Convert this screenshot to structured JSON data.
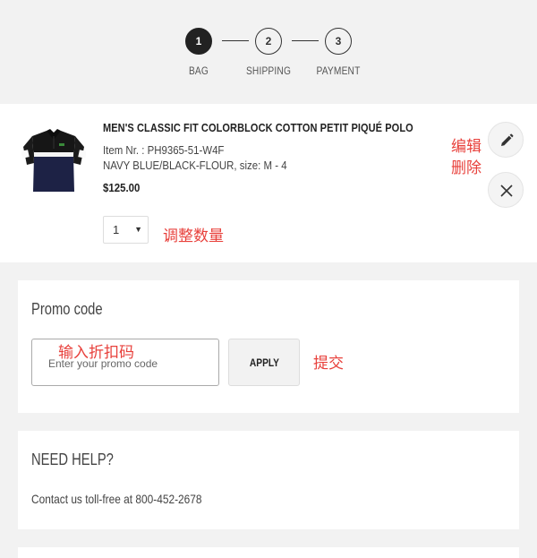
{
  "steps": [
    {
      "number": "1",
      "label": "BAG",
      "active": true
    },
    {
      "number": "2",
      "label": "SHIPPING",
      "active": false
    },
    {
      "number": "3",
      "label": "PAYMENT",
      "active": false
    }
  ],
  "cart_item": {
    "title": "MEN'S CLASSIC FIT COLORBLOCK COTTON PETIT PIQUÉ POLO",
    "item_number": "Item Nr. : PH9365-51-W4F",
    "variant": "NAVY BLUE/BLACK-FLOUR, size: M - 4",
    "price": "$125.00",
    "quantity": "1",
    "image_icon": "polo-shirt-image"
  },
  "annotations": {
    "edit": "编辑",
    "delete": "删除",
    "adjust_quantity": "调整数量",
    "enter_promo": "输入折扣码",
    "submit": "提交"
  },
  "promo": {
    "title": "Promo code",
    "placeholder": "Enter your promo code",
    "value": "",
    "apply_label": "APPLY"
  },
  "help": {
    "title": "NEED HELP?",
    "text": "Contact us toll-free at 800-452-2678"
  },
  "icons": {
    "edit": "pencil-icon",
    "remove": "close-icon",
    "dropdown": "chevron-down-icon"
  },
  "colors": {
    "annotation": "#e8413c",
    "active_step": "#222222",
    "page_background": "#f2f2f2"
  }
}
